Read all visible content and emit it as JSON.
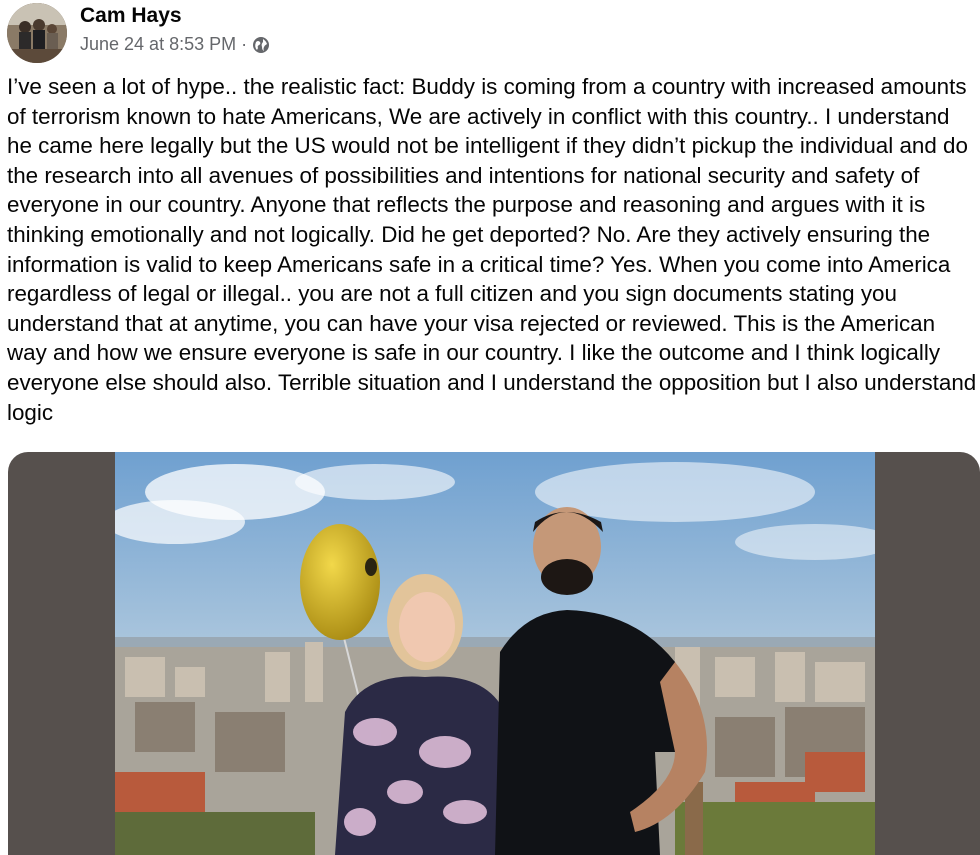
{
  "post": {
    "author_name": "Cam Hays",
    "timestamp": "June 24 at 8:53 PM",
    "separator": "·",
    "audience_icon": "globe-icon",
    "body": "I’ve seen a lot of hype.. the realistic fact: Buddy is coming from a country with increased amounts of terrorism known to hate Americans, We are actively in conflict with this country.. I understand he came here legally but the US would not be intelligent if they didn’t pickup the individual and do the research into all avenues of possibilities and intentions for national security and safety of everyone in our country. Anyone that reflects the purpose and reasoning and argues with it is thinking emotionally and not logically. Did he get deported? No. Are they actively ensuring the information is valid to keep Americans safe in a critical time? Yes. When you come into America regardless of legal or illegal.. you are not a full citizen and you sign documents stating you understand that at anytime, you can have your visa rejected or reviewed. This is the American way and how we ensure everyone is safe in our country. I like the outcome and I think logically everyone else should also. Terrible situation and I understand the opposition but I also understand logic"
  },
  "colors": {
    "text_primary": "#050505",
    "text_secondary": "#65676b",
    "media_background": "#56504d",
    "sky": "#8fb6da"
  }
}
